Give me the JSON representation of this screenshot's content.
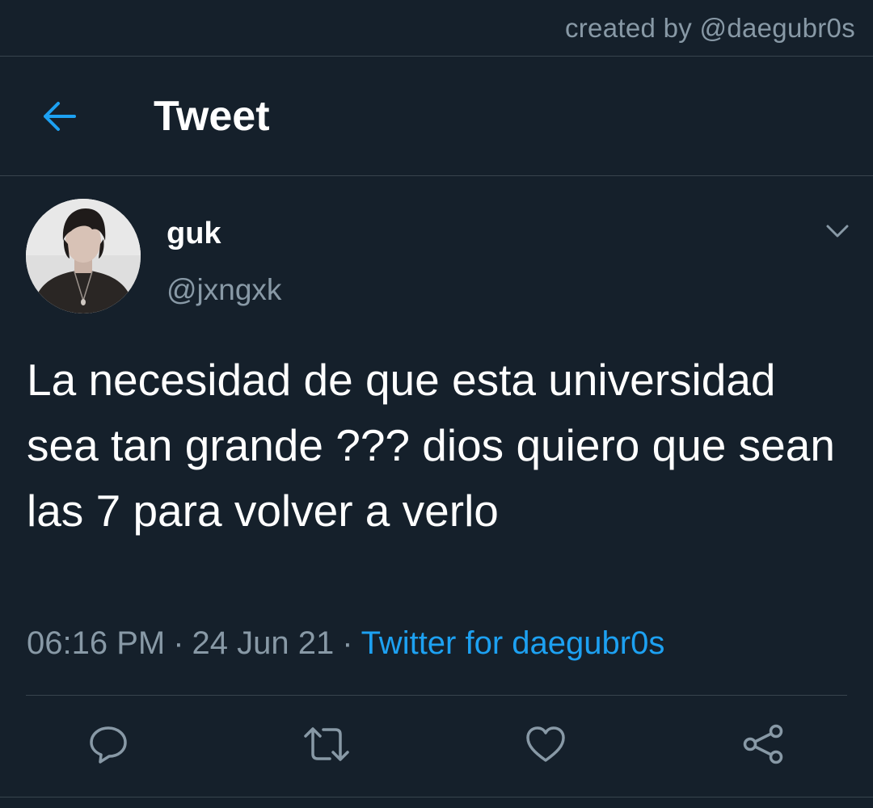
{
  "credit": {
    "text": "created by @daegubr0s"
  },
  "header": {
    "title": "Tweet",
    "back_icon": "arrow-left-icon"
  },
  "tweet": {
    "author_name": "guk",
    "author_handle": "@jxngxk",
    "text": "La necesidad de que esta universidad sea tan grande ??? dios quiero que sean las 7 para volver a verlo",
    "time": "06:16 PM",
    "separator": "·",
    "date": "24 Jun 21",
    "source": "Twitter for daegubr0s"
  },
  "actions": [
    {
      "icon": "reply-icon"
    },
    {
      "icon": "retweet-icon"
    },
    {
      "icon": "like-icon"
    },
    {
      "icon": "share-icon"
    }
  ],
  "colors": {
    "background": "#15202b",
    "divider": "#38444d",
    "secondary_text": "#8899a6",
    "accent": "#1da1f2",
    "primary_text": "#ffffff"
  }
}
